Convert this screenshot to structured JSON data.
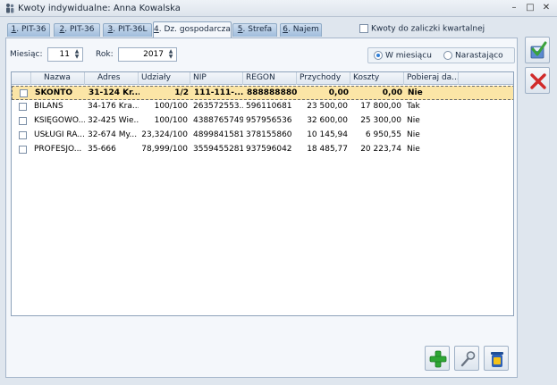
{
  "window": {
    "title": "Kwoty indywidualne: Anna Kowalska"
  },
  "tabs": [
    {
      "num": "1",
      "label": ". PIT-36"
    },
    {
      "num": "2",
      "label": ". PIT-36"
    },
    {
      "num": "3",
      "label": ". PIT-36L"
    },
    {
      "num": "4",
      "label": ". Dz. gospodarcza"
    },
    {
      "num": "5",
      "label": ". Strefa"
    },
    {
      "num": "6",
      "label": ". Najem"
    }
  ],
  "quarterly": {
    "label": "Kwoty do zaliczki kwartalnej"
  },
  "filters": {
    "month_label": "Miesiąc:",
    "month_value": "11",
    "year_label": "Rok:",
    "year_value": "2017",
    "radio_month": "W miesiącu",
    "radio_cumulative": "Narastająco"
  },
  "columns": [
    "Nazwa",
    "Adres",
    "Udziały",
    "NIP",
    "REGON",
    "Przychody",
    "Koszty",
    "Pobieraj da..."
  ],
  "rows": [
    {
      "name": "SKONTO",
      "address": "31-124 Kr...",
      "share": "1/2",
      "nip": "111-111-...",
      "regon": "888888880",
      "income": "0,00",
      "costs": "0,00",
      "fetch": "Nie"
    },
    {
      "name": "BILANS",
      "address": "34-176 Kra...",
      "share": "100/100",
      "nip": "263572553...",
      "regon": "596110681",
      "income": "23 500,00",
      "costs": "17 800,00",
      "fetch": "Tak"
    },
    {
      "name": "KSIĘGOWO...",
      "address": "32-425 Wie...",
      "share": "100/100",
      "nip": "4388765749",
      "regon": "957956536",
      "income": "32 600,00",
      "costs": "25 300,00",
      "fetch": "Nie"
    },
    {
      "name": "USŁUGI RA...",
      "address": "32-674 My...",
      "share": "23,324/100",
      "nip": "4899841581",
      "regon": "378155860",
      "income": "10 145,94",
      "costs": "6 950,55",
      "fetch": "Nie"
    },
    {
      "name": "PROFESJO...",
      "address": "35-666",
      "share": "78,999/100",
      "nip": "3559455281",
      "regon": "937596042",
      "income": "18 485,77",
      "costs": "20 223,74",
      "fetch": "Nie"
    }
  ],
  "icons": {
    "save": "save-check-icon",
    "cancel": "cancel-x-icon",
    "add": "add-plus-icon",
    "edit": "edit-magnifier-icon",
    "delete": "trash-bin-icon"
  }
}
